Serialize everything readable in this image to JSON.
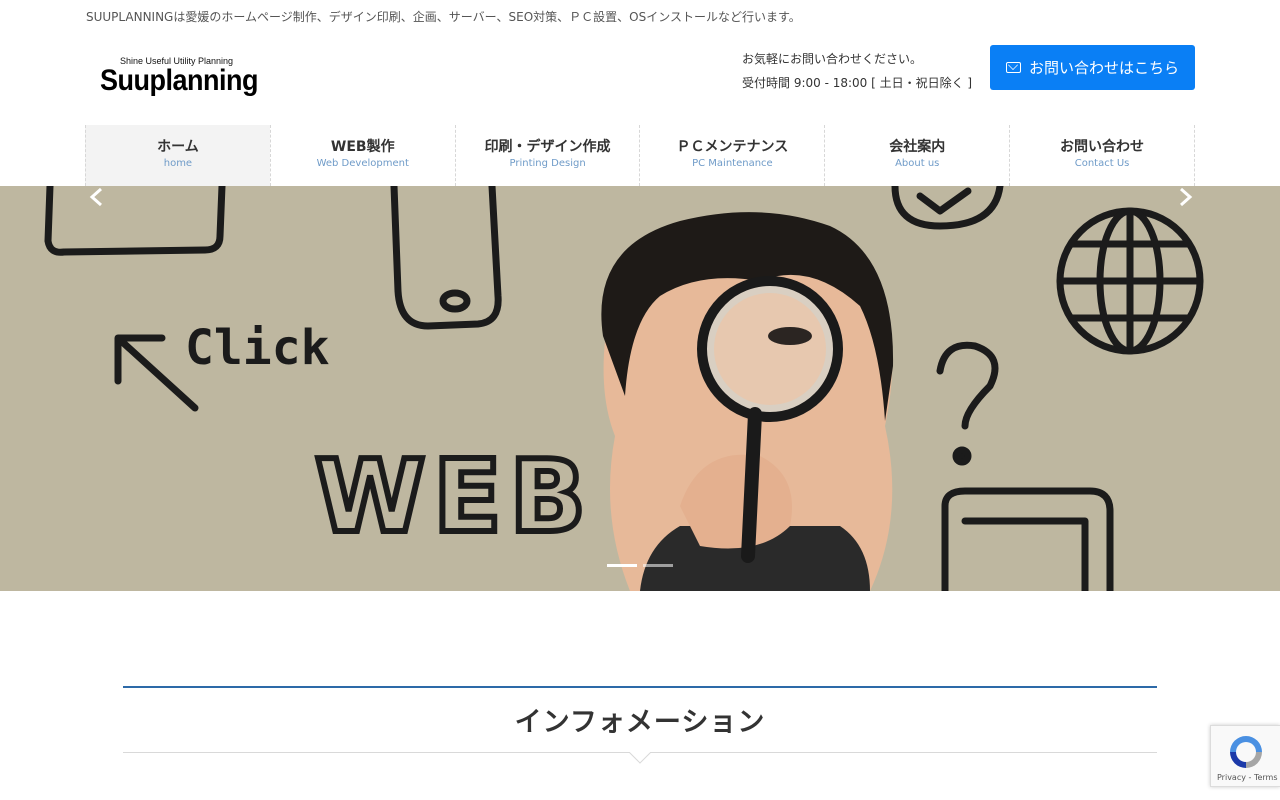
{
  "header": {
    "tagline": "SUUPLANNINGは愛媛のホームページ制作、デザイン印刷、企画、サーバー、SEO対策、ＰＣ設置、OSインストールなど行います。",
    "logo_sub": "Shine Useful Utility Planning",
    "logo_main": "Suuplanning",
    "contact_line1": "お気軽にお問い合わせください。",
    "contact_line2": "受付時間 9:00 - 18:00 [ 土日・祝日除く ]",
    "contact_button": "お問い合わせはこちら",
    "accent_color": "#0a7ff5"
  },
  "nav": {
    "items": [
      {
        "label": "ホーム",
        "sub": "home",
        "active": true
      },
      {
        "label": "WEB製作",
        "sub": "Web Development"
      },
      {
        "label": "印刷・デザイン作成",
        "sub": "Printing Design"
      },
      {
        "label": "ＰＣメンテナンス",
        "sub": "PC Maintenance"
      },
      {
        "label": "会社案内",
        "sub": "About us"
      },
      {
        "label": "お問い合わせ",
        "sub": "Contact Us"
      }
    ]
  },
  "hero": {
    "doodle_click": "Click",
    "doodle_web": "WEB",
    "doodle_question": "?",
    "slide_count": 2,
    "active_slide": 1
  },
  "section": {
    "title": "インフォメーション"
  },
  "recaptcha": {
    "links": "Privacy - Terms"
  }
}
